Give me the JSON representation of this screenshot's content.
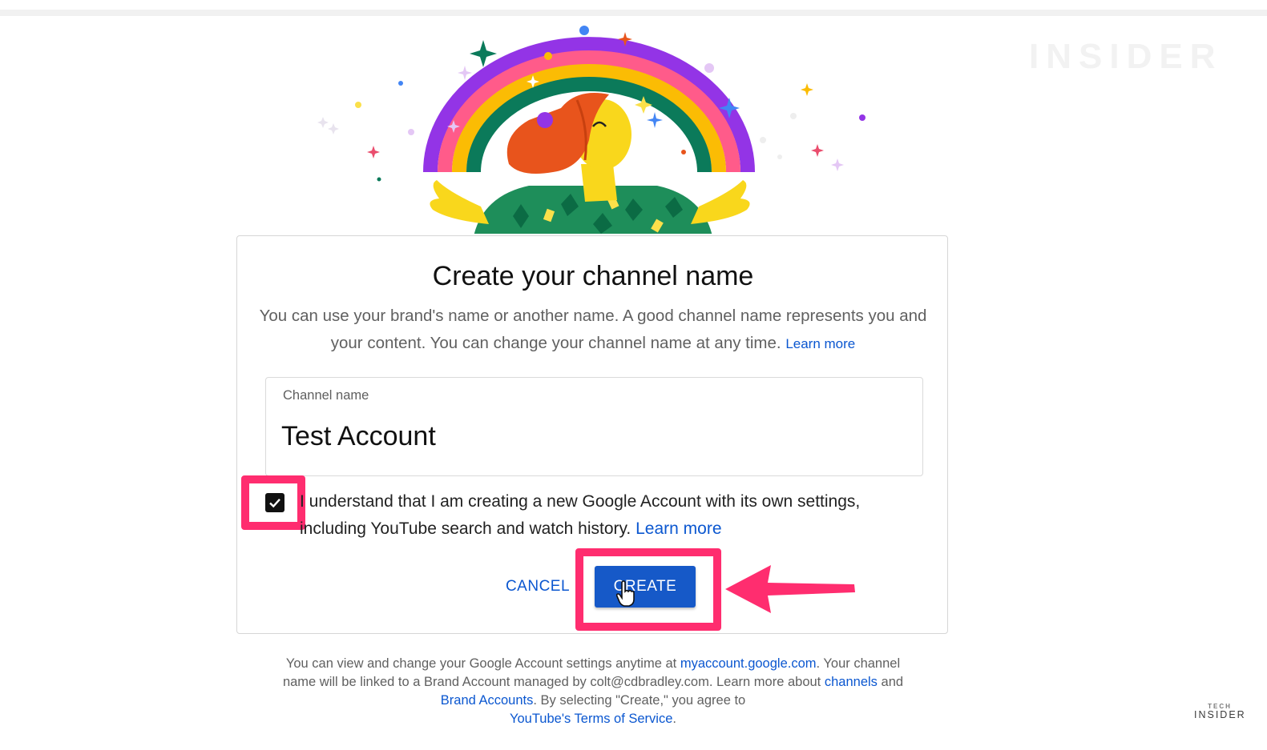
{
  "watermark": "INSIDER",
  "dialog": {
    "title": "Create your channel name",
    "description": "You can use your brand's name or another name. A good channel name represents you and your content. You can change your channel name at any time.",
    "description_link": "Learn more",
    "field_label": "Channel name",
    "field_value": "Test Account",
    "consent_text": "I understand that I am creating a new Google Account with its own settings, including YouTube search and watch history.",
    "consent_link": "Learn more",
    "checkbox_checked": true,
    "cancel_label": "CANCEL",
    "create_label": "CREATE"
  },
  "footer": {
    "line1_text": "You can view and change your Google Account settings anytime at",
    "line1_link": "myaccount.google.com",
    "line1_end": ".",
    "line2_text": "Your channel name will be linked to a Brand Account managed by colt@cdbradley.com. Learn more about",
    "channels_link": "channels",
    "and_text": "and",
    "brand_link": "Brand Accounts",
    "line3_text": ". By selecting \"Create,\" you agree to",
    "tos_link": "YouTube's Terms of Service",
    "tos_end": "."
  },
  "logo": {
    "top": "TECH",
    "bottom": "INSIDER"
  },
  "colors": {
    "accent_blue": "#1659c8",
    "link_blue": "#0b57d0",
    "highlight_pink": "#ff2d6f"
  }
}
